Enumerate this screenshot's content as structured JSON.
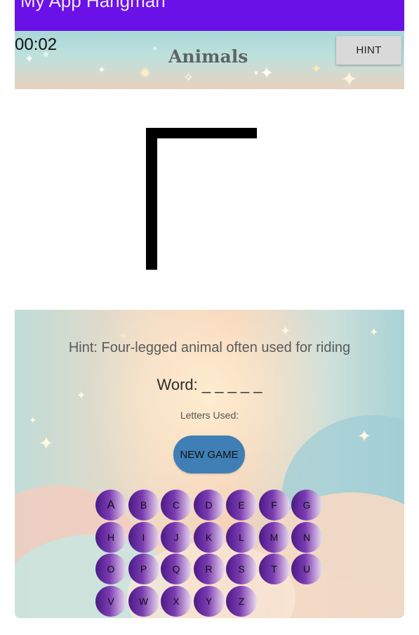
{
  "status_bar": {
    "cut_title": "My App Hangman"
  },
  "header": {
    "timer": "00:02",
    "category": "Animals",
    "hint_button": "HINT"
  },
  "game": {
    "hint": "Hint: Four-legged animal often used for riding",
    "word": "Word: _ _ _ _ _",
    "letters_used": "Letters Used:",
    "new_game_button": "NEW GAME",
    "keys": [
      "A",
      "B",
      "C",
      "D",
      "E",
      "F",
      "G",
      "H",
      "I",
      "J",
      "K",
      "L",
      "M",
      "N",
      "O",
      "P",
      "Q",
      "R",
      "S",
      "T",
      "U",
      "V",
      "W",
      "X",
      "Y",
      "Z"
    ]
  },
  "colors": {
    "status_bar": "#6a11e8",
    "new_game_button": "#3f7fb5",
    "key_dark": "#4a1a86",
    "key_light": "#e9dcee"
  }
}
